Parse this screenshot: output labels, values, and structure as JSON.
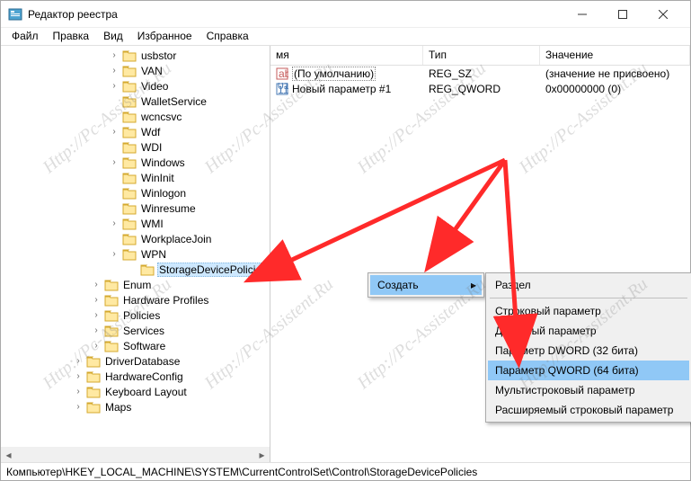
{
  "window": {
    "title": "Редактор реестра"
  },
  "menu": {
    "file": "Файл",
    "edit": "Правка",
    "view": "Вид",
    "favorites": "Избранное",
    "help": "Справка"
  },
  "tree": [
    {
      "indent": 120,
      "exp": "›",
      "label": "usbstor"
    },
    {
      "indent": 120,
      "exp": "›",
      "label": "VAN"
    },
    {
      "indent": 120,
      "exp": "›",
      "label": "Video"
    },
    {
      "indent": 120,
      "exp": "",
      "label": "WalletService"
    },
    {
      "indent": 120,
      "exp": "",
      "label": "wcncsvc"
    },
    {
      "indent": 120,
      "exp": "›",
      "label": "Wdf"
    },
    {
      "indent": 120,
      "exp": "",
      "label": "WDI"
    },
    {
      "indent": 120,
      "exp": "›",
      "label": "Windows"
    },
    {
      "indent": 120,
      "exp": "",
      "label": "WinInit"
    },
    {
      "indent": 120,
      "exp": "",
      "label": "Winlogon"
    },
    {
      "indent": 120,
      "exp": "",
      "label": "Winresume"
    },
    {
      "indent": 120,
      "exp": "›",
      "label": "WMI"
    },
    {
      "indent": 120,
      "exp": "",
      "label": "WorkplaceJoin"
    },
    {
      "indent": 120,
      "exp": "›",
      "label": "WPN"
    },
    {
      "indent": 140,
      "exp": "",
      "label": "StorageDevicePolicies",
      "selected": true
    },
    {
      "indent": 100,
      "exp": "›",
      "label": "Enum"
    },
    {
      "indent": 100,
      "exp": "›",
      "label": "Hardware Profiles"
    },
    {
      "indent": 100,
      "exp": "›",
      "label": "Policies"
    },
    {
      "indent": 100,
      "exp": "›",
      "label": "Services"
    },
    {
      "indent": 100,
      "exp": "›",
      "label": "Software"
    },
    {
      "indent": 80,
      "exp": "›",
      "label": "DriverDatabase"
    },
    {
      "indent": 80,
      "exp": "›",
      "label": "HardwareConfig"
    },
    {
      "indent": 80,
      "exp": "›",
      "label": "Keyboard Layout"
    },
    {
      "indent": 80,
      "exp": "›",
      "label": "Maps"
    }
  ],
  "list": {
    "headers": {
      "name": "мя",
      "type": "Тип",
      "value": "Значение"
    },
    "rows": [
      {
        "name": "(По умолчанию)",
        "boxed": true,
        "type": "REG_SZ",
        "value": "(значение не присвоено)",
        "icon": "str"
      },
      {
        "name": "Новый параметр #1",
        "boxed": false,
        "type": "REG_QWORD",
        "value": "0x00000000 (0)",
        "icon": "bin"
      }
    ]
  },
  "context": {
    "create": "Создать",
    "submenu": [
      {
        "label": "Раздел"
      },
      {
        "label": "Строковый параметр"
      },
      {
        "label": "Двоичный параметр"
      },
      {
        "label": "Параметр DWORD (32 бита)"
      },
      {
        "label": "Параметр QWORD (64 бита)",
        "highlight": true
      },
      {
        "label": "Мультистроковый параметр"
      },
      {
        "label": "Расширяемый строковый параметр"
      }
    ]
  },
  "statusbar": {
    "path": "Компьютер\\HKEY_LOCAL_MACHINE\\SYSTEM\\CurrentControlSet\\Control\\StorageDevicePolicies"
  },
  "watermark": "Http://Pc-Assistent.Ru"
}
